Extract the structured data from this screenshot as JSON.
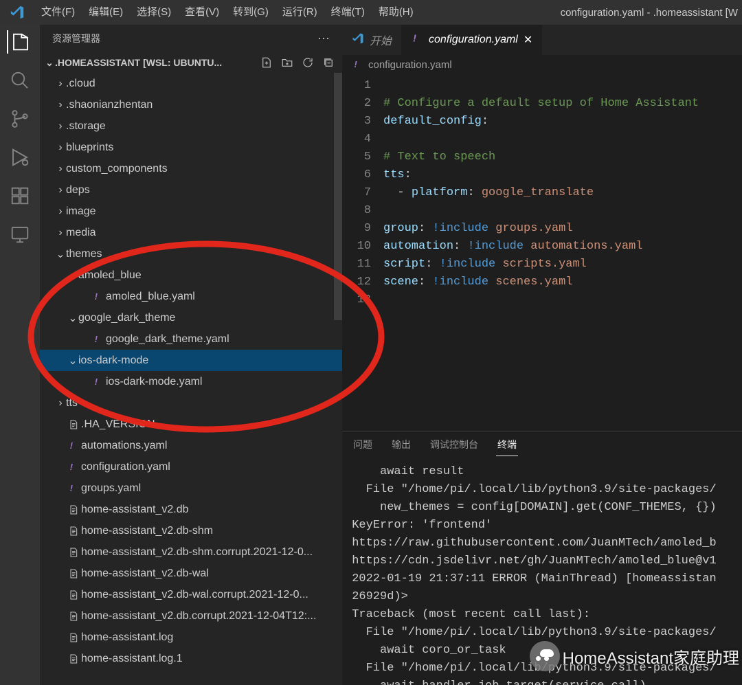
{
  "menu": [
    "文件(F)",
    "编辑(E)",
    "选择(S)",
    "查看(V)",
    "转到(G)",
    "运行(R)",
    "终端(T)",
    "帮助(H)"
  ],
  "windowTitle": "configuration.yaml - .homeassistant [W",
  "sidebar": {
    "title": "资源管理器",
    "section": ".HOMEASSISTANT [WSL: UBUNTU...",
    "tree": [
      {
        "depth": 0,
        "kind": "folder",
        "open": false,
        "name": ".cloud"
      },
      {
        "depth": 0,
        "kind": "folder",
        "open": false,
        "name": ".shaonianzhentan"
      },
      {
        "depth": 0,
        "kind": "folder",
        "open": false,
        "name": ".storage"
      },
      {
        "depth": 0,
        "kind": "folder",
        "open": false,
        "name": "blueprints"
      },
      {
        "depth": 0,
        "kind": "folder",
        "open": false,
        "name": "custom_components"
      },
      {
        "depth": 0,
        "kind": "folder",
        "open": false,
        "name": "deps"
      },
      {
        "depth": 0,
        "kind": "folder",
        "open": false,
        "name": "image"
      },
      {
        "depth": 0,
        "kind": "folder",
        "open": false,
        "name": "media"
      },
      {
        "depth": 0,
        "kind": "folder",
        "open": true,
        "name": "themes"
      },
      {
        "depth": 1,
        "kind": "folder",
        "open": true,
        "name": "amoled_blue"
      },
      {
        "depth": 2,
        "kind": "yaml",
        "name": "amoled_blue.yaml"
      },
      {
        "depth": 1,
        "kind": "folder",
        "open": true,
        "name": "google_dark_theme"
      },
      {
        "depth": 2,
        "kind": "yaml",
        "name": "google_dark_theme.yaml"
      },
      {
        "depth": 1,
        "kind": "folder",
        "open": true,
        "name": "ios-dark-mode",
        "selected": true
      },
      {
        "depth": 2,
        "kind": "yaml",
        "name": "ios-dark-mode.yaml"
      },
      {
        "depth": 0,
        "kind": "folder",
        "open": false,
        "name": "tts"
      },
      {
        "depth": 0,
        "kind": "text",
        "name": ".HA_VERSION"
      },
      {
        "depth": 0,
        "kind": "yaml",
        "name": "automations.yaml"
      },
      {
        "depth": 0,
        "kind": "yaml",
        "name": "configuration.yaml"
      },
      {
        "depth": 0,
        "kind": "yaml",
        "name": "groups.yaml"
      },
      {
        "depth": 0,
        "kind": "text",
        "name": "home-assistant_v2.db"
      },
      {
        "depth": 0,
        "kind": "text",
        "name": "home-assistant_v2.db-shm"
      },
      {
        "depth": 0,
        "kind": "text",
        "name": "home-assistant_v2.db-shm.corrupt.2021-12-0..."
      },
      {
        "depth": 0,
        "kind": "text",
        "name": "home-assistant_v2.db-wal"
      },
      {
        "depth": 0,
        "kind": "text",
        "name": "home-assistant_v2.db-wal.corrupt.2021-12-0..."
      },
      {
        "depth": 0,
        "kind": "text",
        "name": "home-assistant_v2.db.corrupt.2021-12-04T12:..."
      },
      {
        "depth": 0,
        "kind": "text",
        "name": "home-assistant.log"
      },
      {
        "depth": 0,
        "kind": "text",
        "name": "home-assistant.log.1"
      }
    ]
  },
  "tabs": [
    {
      "label": "开始",
      "icon": "vscode",
      "active": false
    },
    {
      "label": "configuration.yaml",
      "icon": "yaml",
      "active": true,
      "close": true
    }
  ],
  "breadcrumb": "configuration.yaml",
  "code": {
    "lines": [
      {
        "n": 1,
        "seg": []
      },
      {
        "n": 2,
        "seg": [
          {
            "t": "# Configure a default setup of Home Assistant",
            "c": "c-comment"
          }
        ]
      },
      {
        "n": 3,
        "seg": [
          {
            "t": "default_config",
            "c": "c-key"
          },
          {
            "t": ":",
            "c": "c-punc"
          }
        ]
      },
      {
        "n": 4,
        "seg": []
      },
      {
        "n": 5,
        "seg": [
          {
            "t": "# Text to speech",
            "c": "c-comment"
          }
        ]
      },
      {
        "n": 6,
        "seg": [
          {
            "t": "tts",
            "c": "c-key"
          },
          {
            "t": ":",
            "c": "c-punc"
          }
        ]
      },
      {
        "n": 7,
        "seg": [
          {
            "t": "  - ",
            "c": "c-punc"
          },
          {
            "t": "platform",
            "c": "c-key"
          },
          {
            "t": ": ",
            "c": "c-punc"
          },
          {
            "t": "google_translate",
            "c": "c-str"
          }
        ]
      },
      {
        "n": 8,
        "seg": []
      },
      {
        "n": 9,
        "seg": [
          {
            "t": "group",
            "c": "c-key"
          },
          {
            "t": ": ",
            "c": "c-punc"
          },
          {
            "t": "!include",
            "c": "c-tag"
          },
          {
            "t": " ",
            "c": "c-punc"
          },
          {
            "t": "groups.yaml",
            "c": "c-str"
          }
        ]
      },
      {
        "n": 10,
        "seg": [
          {
            "t": "automation",
            "c": "c-key"
          },
          {
            "t": ": ",
            "c": "c-punc"
          },
          {
            "t": "!include",
            "c": "c-tag"
          },
          {
            "t": " ",
            "c": "c-punc"
          },
          {
            "t": "automations.yaml",
            "c": "c-str"
          }
        ]
      },
      {
        "n": 11,
        "seg": [
          {
            "t": "script",
            "c": "c-key"
          },
          {
            "t": ": ",
            "c": "c-punc"
          },
          {
            "t": "!include",
            "c": "c-tag"
          },
          {
            "t": " ",
            "c": "c-punc"
          },
          {
            "t": "scripts.yaml",
            "c": "c-str"
          }
        ]
      },
      {
        "n": 12,
        "seg": [
          {
            "t": "scene",
            "c": "c-key"
          },
          {
            "t": ": ",
            "c": "c-punc"
          },
          {
            "t": "!include",
            "c": "c-tag"
          },
          {
            "t": " ",
            "c": "c-punc"
          },
          {
            "t": "scenes.yaml",
            "c": "c-str"
          }
        ]
      },
      {
        "n": 13,
        "seg": []
      }
    ]
  },
  "panel": {
    "tabs": [
      "问题",
      "输出",
      "调试控制台",
      "终端"
    ],
    "activeTab": 3,
    "terminal": "     await result\n   File \"/home/pi/.local/lib/python3.9/site-packages/\n     new_themes = config[DOMAIN].get(CONF_THEMES, {})\n KeyError: 'frontend'\n https://raw.githubusercontent.com/JuanMTech/amoled_b\n https://cdn.jsdelivr.net/gh/JuanMTech/amoled_blue@v1\n 2022-01-19 21:37:11 ERROR (MainThread) [homeassistan\n 26929d)>\n Traceback (most recent call last):\n   File \"/home/pi/.local/lib/python3.9/site-packages/\n     await coro_or_task\n   File \"/home/pi/.local/lib/python3.9/site-packages/\n     await handler.job.target(service_call)"
  },
  "watermark": "HomeAssistant家庭助理"
}
